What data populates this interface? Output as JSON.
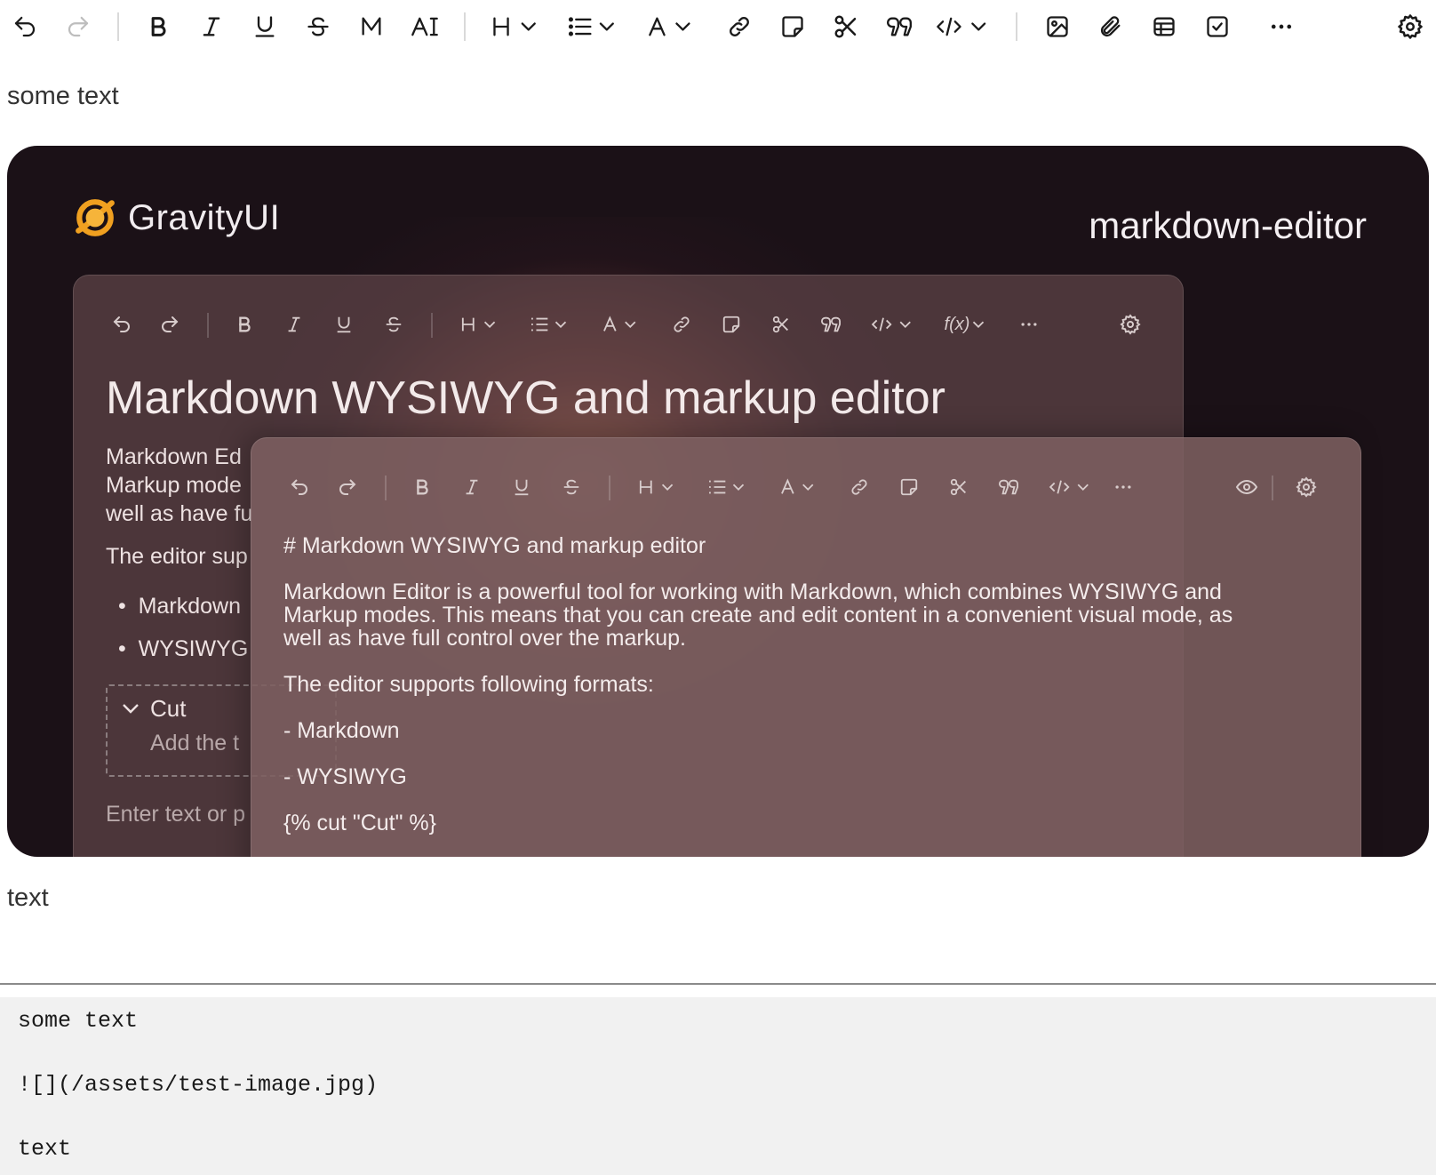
{
  "toolbar": {
    "items": [
      "undo",
      "redo",
      "bold",
      "italic",
      "underline",
      "strikethrough",
      "mono",
      "mark",
      "heading",
      "list",
      "text-color",
      "link",
      "note",
      "cut",
      "quote",
      "code",
      "image",
      "file",
      "table",
      "checkbox",
      "more",
      "settings"
    ]
  },
  "content": {
    "paragraph1": "some text",
    "paragraph2": "text"
  },
  "image": {
    "brand": "GravityUI",
    "package": "markdown-editor",
    "back_editor": {
      "title": "Markdown WYSIWYG and markup editor",
      "lines": [
        "Markdown Ed",
        "Markup mode",
        "well as have fu",
        "The editor sup"
      ],
      "bullets": [
        "Markdown",
        "WYSIWYG"
      ],
      "cut_title": "Cut",
      "cut_placeholder": "Add the t",
      "placeholder": "Enter text or p",
      "formula_label": "f(x)"
    },
    "front_editor": {
      "lines": [
        "# Markdown WYSIWYG and markup editor",
        "Markdown Editor is a powerful tool for working with Markdown, which combines WYSIWYG and",
        "Markup modes. This means that you can create and edit content in a convenient visual mode, as",
        "well as have full control over the markup.",
        "The editor supports following formats:",
        "- Markdown",
        "- WYSIWYG",
        "{% cut \"Cut\" %}"
      ]
    }
  },
  "source": {
    "lines": [
      "some text",
      "![](/assets/test-image.jpg)",
      "text"
    ]
  },
  "colors": {
    "image_bg": "#1b1117",
    "accent_orange": "#f0a020",
    "source_bg": "#f1f1f1"
  }
}
